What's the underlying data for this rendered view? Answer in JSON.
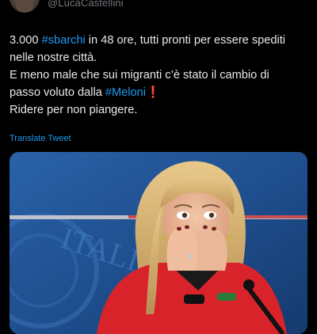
{
  "author": {
    "handle": "@LucaCastellini"
  },
  "tweet": {
    "line1_prefix": "3.000 ",
    "line1_hashtag": "#sbarchi",
    "line1_suffix": " in 48 ore, tutti pronti per essere spediti",
    "line2": "nelle nostre città.",
    "line3": "E meno male che sui migranti c’è stato il cambio di",
    "line4_prefix": "passo voluto dalla ",
    "line4_hashtag": "#Meloni",
    "line4_mark": "❗",
    "line5": "Ridere per non piangere."
  },
  "translate_label": "Translate Tweet",
  "media": {
    "backdrop_letters": "ITALIA"
  },
  "colors": {
    "background": "#000000",
    "text": "#e7e9ea",
    "muted": "#71767b",
    "link": "#1d9bf0",
    "mark": "#f4212e",
    "backdrop_blue": "#1f4f8f",
    "jacket_red": "#d8232a"
  }
}
